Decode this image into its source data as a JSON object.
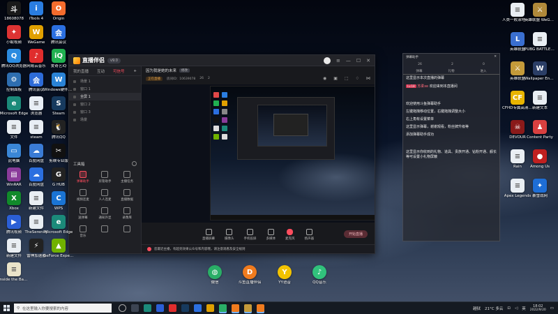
{
  "desktop": {
    "left_icons": [
      {
        "label": "18608078",
        "color": "#1a1a1a",
        "glyph": "斗"
      },
      {
        "label": "iTools 4",
        "color": "#2a7de1",
        "glyph": "i"
      },
      {
        "label": "Origin",
        "color": "#f56c2d",
        "glyph": "O"
      },
      {
        "label": "小蚁视频",
        "color": "#d33",
        "glyph": "✦"
      },
      {
        "label": "WeGame",
        "color": "#e0a000",
        "glyph": "W"
      },
      {
        "label": "腾讯会议",
        "color": "#2b6fe0",
        "glyph": "会"
      },
      {
        "label": "腾讯QQ浏览器",
        "color": "#2b8be0",
        "glyph": "Q"
      },
      {
        "label": "网易云音乐",
        "color": "#e02d2d",
        "glyph": "♪"
      },
      {
        "label": "爱奇艺iQ",
        "color": "#20b050",
        "glyph": "iQ"
      },
      {
        "label": "控制面板",
        "color": "#2e6eb0",
        "glyph": "⚙"
      },
      {
        "label": "腾讯会议",
        "color": "#2d6bd8",
        "glyph": "会"
      },
      {
        "label": "Windows硬件助手",
        "color": "#2a83d6",
        "glyph": "W"
      },
      {
        "label": "Microsoft Edge",
        "color": "#1b8a7a",
        "glyph": "e"
      },
      {
        "label": "浏览器",
        "color": "#e8eef5",
        "glyph": "≡"
      },
      {
        "label": "Steam",
        "color": "#173a5e",
        "glyph": "S"
      },
      {
        "label": "文件",
        "color": "#e9eef3",
        "glyph": "≡"
      },
      {
        "label": "steam",
        "color": "#e8eef5",
        "glyph": "≡"
      },
      {
        "label": "腾讯QQ",
        "color": "#222",
        "glyph": "🐧"
      },
      {
        "label": "此电脑",
        "color": "#3a86d6",
        "glyph": "▭"
      },
      {
        "label": "百度网盘",
        "color": "#3a7bd5",
        "glyph": "☁"
      },
      {
        "label": "剪映专业版",
        "color": "#111",
        "glyph": "✂"
      },
      {
        "label": "WinRAR",
        "color": "#8a3b9a",
        "glyph": "▤"
      },
      {
        "label": "百度网盘",
        "color": "#2b6fe0",
        "glyph": "☁"
      },
      {
        "label": "G HUB",
        "color": "#222",
        "glyph": "G"
      },
      {
        "label": "Xbox",
        "color": "#118a2a",
        "glyph": "X"
      },
      {
        "label": "新建文件",
        "color": "#e9eef3",
        "glyph": "≡"
      },
      {
        "label": "WPS",
        "color": "#1a74d4",
        "glyph": "C"
      },
      {
        "label": "腾讯视频",
        "color": "#2b5fd6",
        "glyph": "▶"
      },
      {
        "label": "TheSerenity",
        "color": "#e9eef3",
        "glyph": "≡"
      },
      {
        "label": "Microsoft Edge",
        "color": "#1b8a7a",
        "glyph": "e"
      },
      {
        "label": "新建文件",
        "color": "#e9eef3",
        "glyph": "≡"
      },
      {
        "label": "雷神加速器",
        "color": "#222",
        "glyph": "⚡"
      },
      {
        "label": "GeForce Experience",
        "color": "#70b200",
        "glyph": "▲"
      },
      {
        "label": "Inside the Backrooms",
        "color": "#e9e3c9",
        "glyph": "≡"
      }
    ],
    "right_icons": [
      {
        "label": "人类一败涂地 Human Fa...",
        "color": "#e9eef3",
        "glyph": "≡"
      },
      {
        "label": "英雄联盟 WeGame版",
        "color": "#b0893a",
        "glyph": "⚔"
      },
      {
        "label": "英雄联盟",
        "color": "#3a6fd0",
        "glyph": "L"
      },
      {
        "label": "PUBG BATTLEGR...",
        "color": "#e9eef3",
        "glyph": "≡"
      },
      {
        "label": "英雄联盟",
        "color": "#c49a3a",
        "glyph": "⚔"
      },
      {
        "label": "Wallpaper Engine: ...",
        "color": "#2b3e66",
        "glyph": "W"
      },
      {
        "label": "CFHD专属高清大区",
        "color": "#e8b400",
        "glyph": "CF"
      },
      {
        "label": "新建文本",
        "color": "#e9eef3",
        "glyph": "≡"
      },
      {
        "label": "DEVOUR",
        "color": "#8a1a1a",
        "glyph": "☠"
      },
      {
        "label": "Content Party",
        "color": "#d84040",
        "glyph": "♟"
      },
      {
        "label": "Rain",
        "color": "#e9eef3",
        "glyph": "≡"
      },
      {
        "label": "Among Us",
        "color": "#c02020",
        "glyph": "●"
      },
      {
        "label": "Apex Legends",
        "color": "#e9eef3",
        "glyph": "≡"
      },
      {
        "label": "暴雪战网",
        "color": "#1e6ed6",
        "glyph": "✦"
      },
      {
        "label": "百度翻译",
        "color": "#f2c300",
        "glyph": "◑"
      }
    ],
    "dock_icons": [
      {
        "label": "微信",
        "color": "#2aae67",
        "glyph": "◍"
      },
      {
        "label": "斗鱼直播伴侣",
        "color": "#f07b1e",
        "glyph": "D"
      },
      {
        "label": "YY语音",
        "color": "#f3c300",
        "glyph": "Y"
      },
      {
        "label": "QQ音乐",
        "color": "#31c27c",
        "glyph": "♪"
      }
    ]
  },
  "app": {
    "name": "直播伴侣",
    "version": "v9.0",
    "tabs": [
      "我的直播",
      "互动",
      "可信号"
    ],
    "active_tab": "可信号",
    "scenes": [
      "场景 1",
      "窗口 1",
      "全屏 1",
      "窗口 2",
      "窗口 3",
      "场景"
    ],
    "tools_title": "工具箱",
    "tools": [
      "弹幕助手",
      "房管助手",
      "主播任务",
      "视频连麦",
      "人人连麦",
      "直播数据",
      "送弹幕",
      "通知外显",
      "录像库",
      "音乐",
      "",
      ""
    ],
    "room_title": "因为我是她的未来",
    "edit_label": "修改",
    "room_tag": "正在直播",
    "room_id_label": "房间ID：10639078",
    "room_views": "26",
    "room_fans": "2",
    "bottom_tools": [
      "直播屏幕",
      "摄像头",
      "手机投屏",
      "多媒体",
      "麦克风",
      "扬声器"
    ],
    "start_label": "开始直播",
    "notice": "您最近主播，有超亮效果公众号和内容哦，请注意观看及安全规则"
  },
  "chat": {
    "title": "弹幕助手",
    "stats": [
      "26",
      "2",
      "0"
    ],
    "tabs": [
      "弹幕",
      "礼物",
      "进入"
    ],
    "lines": [
      {
        "user": "",
        "text": "这里显示本次直播的弹幕"
      },
      {
        "user": "苏柔xe",
        "level": "Lv.18",
        "text": "欢迎来到本直播间"
      },
      {
        "user": "",
        "text": "欢迎使用斗鱼弹幕助手"
      },
      {
        "user": "",
        "text": "左键拖拽移动位置，右键拖拽调整大小"
      },
      {
        "user": "",
        "text": "右上角有设置菜单"
      },
      {
        "user": "",
        "text": "这里显示弹幕，谢谢观看，粉丝牌升级等"
      },
      {
        "user": "",
        "text": "添加弹幕助手成功"
      },
      {
        "user": "",
        "text": "这里显示你收到的礼物、道具、贵族开通、钻粉开通、舰长等可设置小礼物屏蔽"
      }
    ]
  },
  "taskbar": {
    "search_placeholder": "在这里输入你要搜索的内容",
    "tray_text": "越狱",
    "weather": "21°C 多云",
    "ime": "英",
    "time": "18:02",
    "date": "2022/9/20"
  }
}
